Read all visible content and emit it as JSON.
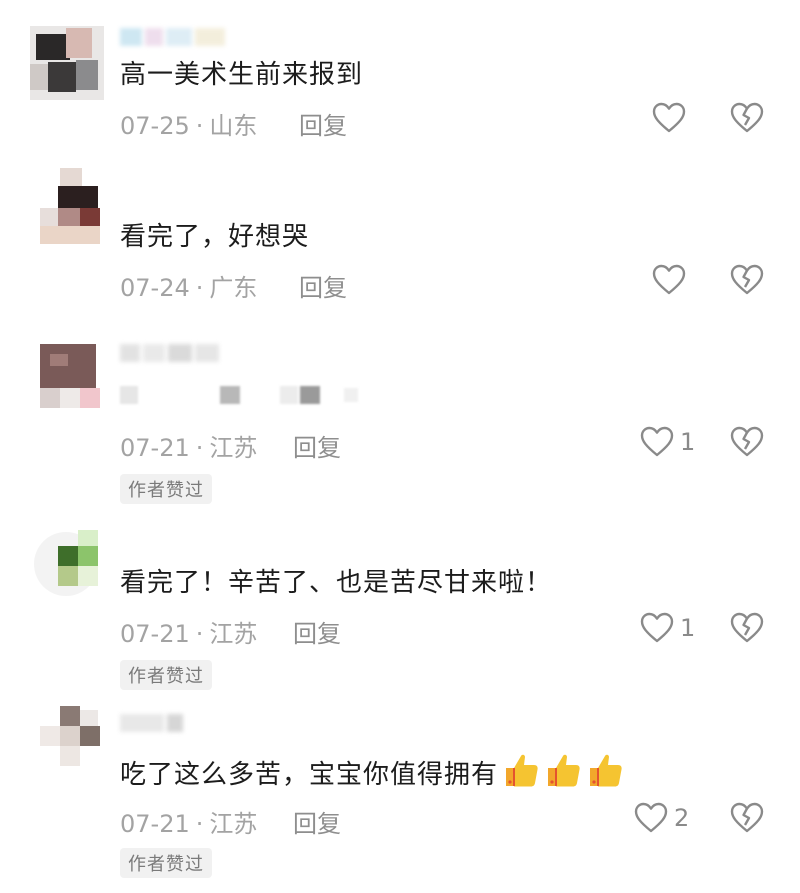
{
  "comments": [
    {
      "text": "高一美术生前来报到",
      "date": "07-25",
      "location": "山东",
      "reply": "回复",
      "likes": "",
      "author_liked": ""
    },
    {
      "text": "看完了，好想哭",
      "date": "07-24",
      "location": "广东",
      "reply": "回复",
      "likes": "",
      "author_liked": ""
    },
    {
      "text": "",
      "date": "07-21",
      "location": "江苏",
      "reply": "回复",
      "likes": "1",
      "author_liked": "作者赞过"
    },
    {
      "text": "看完了！辛苦了、也是苦尽甘来啦！",
      "date": "07-21",
      "location": "江苏",
      "reply": "回复",
      "likes": "1",
      "author_liked": "作者赞过"
    },
    {
      "text": "吃了这么多苦，宝宝你值得拥有",
      "date": "07-21",
      "location": "江苏",
      "reply": "回复",
      "likes": "2",
      "author_liked": "作者赞过",
      "emoji": "thumbs-up x3"
    }
  ],
  "separator": "·",
  "colors": {
    "meta_text": "#a3a3a3",
    "icon_stroke": "#8a8a8a",
    "badge_bg": "#f1f1f1",
    "thumb": "#f5b921"
  }
}
